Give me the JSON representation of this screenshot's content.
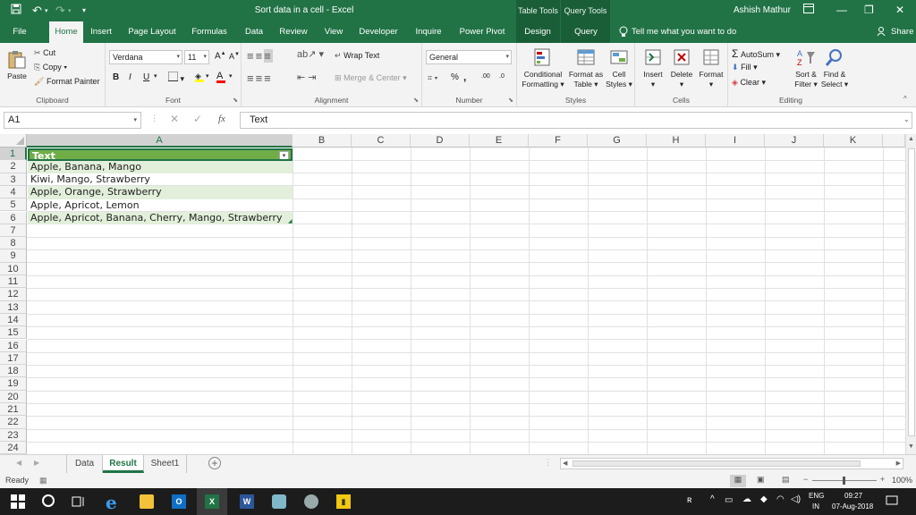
{
  "title": {
    "doc": "Sort data in a cell  -  Excel",
    "ctx_table": "Table Tools",
    "ctx_query": "Query Tools",
    "user": "Ashish Mathur"
  },
  "tabs": [
    "File",
    "Home",
    "Insert",
    "Page Layout",
    "Formulas",
    "Data",
    "Review",
    "View",
    "Developer",
    "Inquire",
    "Power Pivot",
    "Design",
    "Query"
  ],
  "tell_me": "Tell me what you want to do",
  "share": "Share",
  "ribbon": {
    "clipboard": {
      "paste": "Paste",
      "cut": "Cut",
      "copy": "Copy",
      "format_painter": "Format Painter",
      "label": "Clipboard"
    },
    "font": {
      "name": "Verdana",
      "size": "11",
      "bold": "B",
      "italic": "I",
      "underline": "U",
      "grow": "A",
      "shrink": "A",
      "label": "Font"
    },
    "alignment": {
      "wrap": "Wrap Text",
      "merge": "Merge & Center",
      "label": "Alignment"
    },
    "number": {
      "format": "General",
      "percent": "%",
      "comma": ",",
      "inc": ".00",
      "dec": ".0",
      "label": "Number"
    },
    "styles": {
      "conditional": "Conditional",
      "conditional2": "Formatting",
      "format_as": "Format as",
      "format_as2": "Table",
      "cell": "Cell",
      "cell2": "Styles",
      "label": "Styles"
    },
    "cells": {
      "insert": "Insert",
      "delete": "Delete",
      "format": "Format",
      "label": "Cells"
    },
    "editing": {
      "autosum": "AutoSum",
      "fill": "Fill",
      "clear": "Clear",
      "sort": "Sort &",
      "sort2": "Filter",
      "find": "Find &",
      "find2": "Select",
      "label": "Editing"
    }
  },
  "formula": {
    "namebox": "A1",
    "fx": "fx",
    "value": "Text"
  },
  "columns": [
    "A",
    "B",
    "C",
    "D",
    "E",
    "F",
    "G",
    "H",
    "I",
    "J",
    "K"
  ],
  "rows": [
    "1",
    "2",
    "3",
    "4",
    "5",
    "6",
    "7",
    "8",
    "9",
    "10",
    "11",
    "12",
    "13",
    "14",
    "15",
    "16",
    "17",
    "18",
    "19",
    "20",
    "21",
    "22",
    "23",
    "24"
  ],
  "cells": [
    "Text",
    "Apple, Banana, Mango",
    "Kiwi, Mango, Strawberry",
    "Apple, Orange, Strawberry",
    "Apple, Apricot, Lemon",
    "Apple, Apricot, Banana, Cherry, Mango, Strawberry"
  ],
  "sheets": [
    "Data",
    "Result",
    "Sheet1"
  ],
  "status": {
    "ready": "Ready",
    "zoom": "100%"
  },
  "taskbar": {
    "lang1": "ENG",
    "lang2": "IN",
    "time": "09:27",
    "date": "07-Aug-2018"
  }
}
